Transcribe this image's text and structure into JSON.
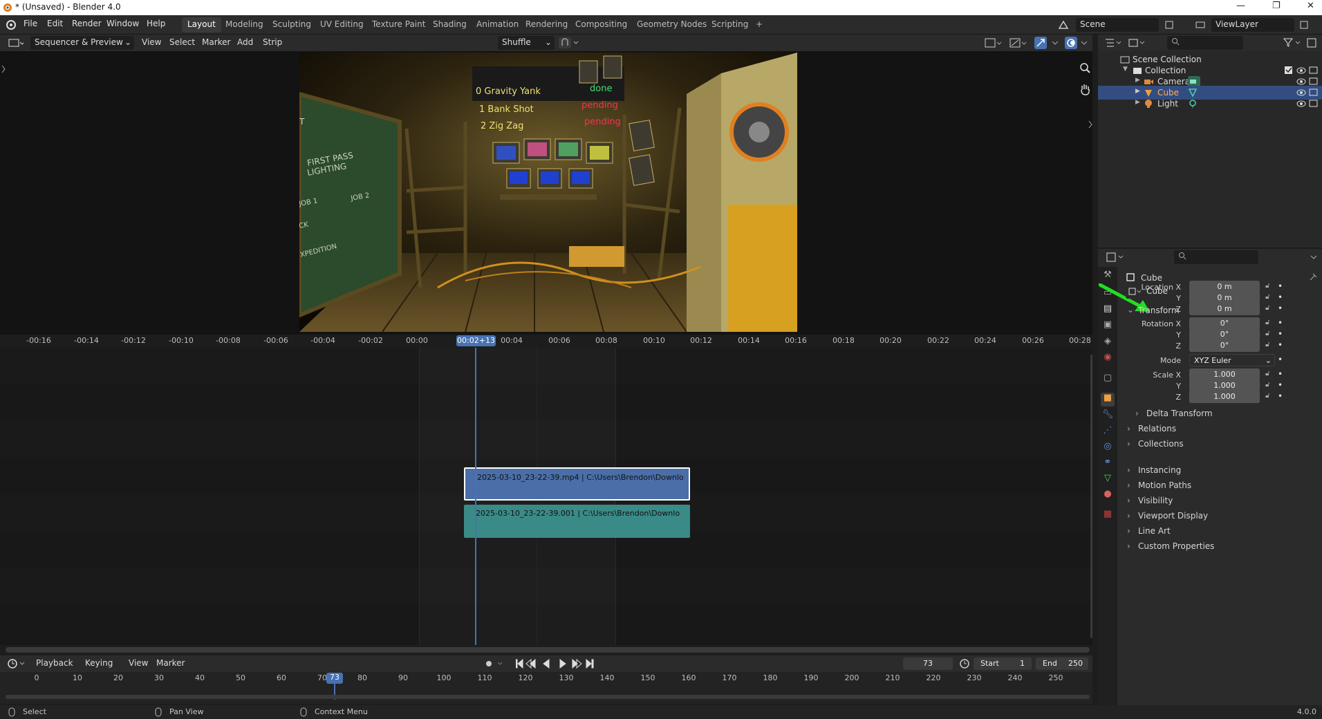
{
  "window": {
    "title": "* (Unsaved) - Blender 4.0",
    "minimize": "—",
    "maximize": "❐",
    "close": "✕"
  },
  "menu": {
    "items": [
      "File",
      "Edit",
      "Render",
      "Window",
      "Help"
    ]
  },
  "workspaces": {
    "tabs": [
      "Layout",
      "Modeling",
      "Sculpting",
      "UV Editing",
      "Texture Paint",
      "Shading",
      "Animation",
      "Rendering",
      "Compositing",
      "Geometry Nodes",
      "Scripting"
    ],
    "active": "Layout",
    "add": "+"
  },
  "scene": {
    "name": "Scene",
    "view_layer": "ViewLayer"
  },
  "sequencer": {
    "view_mode": "Sequencer & Preview",
    "menus": [
      "View",
      "Select",
      "Marker",
      "Add",
      "Strip"
    ],
    "overlap_mode": "Shuffle",
    "ruler_ticks": [
      "-00:16",
      "-00:14",
      "-00:12",
      "-00:10",
      "-00:08",
      "-00:06",
      "-00:04",
      "-00:02",
      "00:00",
      "00:04",
      "00:06",
      "00:08",
      "00:10",
      "00:12",
      "00:14",
      "00:16",
      "00:18",
      "00:20",
      "00:22",
      "00:24",
      "00:26",
      "00:28"
    ],
    "current_time": "00:02+13",
    "strips": [
      {
        "label": "2025-03-10_23-22-39.mp4 | C:\\Users\\Brendon\\Downlo",
        "type": "movie",
        "color": "#4a6ea8"
      },
      {
        "label": "2025-03-10_23-22-39.001 | C:\\Users\\Brendon\\Downlo",
        "type": "sound",
        "color": "#3a8a87"
      }
    ],
    "preview_text": {
      "board_lines": [
        "0 Gravity Yank",
        "1 Bank Shot",
        "2 Zig Zag"
      ],
      "board_status": [
        "done",
        "pending",
        "pending"
      ],
      "chalk_lines": [
        "FIRST PASS",
        "LIGHTING",
        "JOB 1",
        "JOB 2",
        "CK",
        "XPEDITION",
        "T"
      ]
    }
  },
  "timeline": {
    "menus": [
      "Playback",
      "Keying",
      "View",
      "Marker"
    ],
    "current_frame": "73",
    "start_label": "Start",
    "start": "1",
    "end_label": "End",
    "end": "250",
    "ticks": [
      "0",
      "10",
      "20",
      "30",
      "40",
      "50",
      "60",
      "70",
      "80",
      "90",
      "100",
      "110",
      "120",
      "130",
      "140",
      "150",
      "160",
      "170",
      "180",
      "190",
      "200",
      "210",
      "220",
      "230",
      "240",
      "250"
    ]
  },
  "status_bar": {
    "items": [
      "Select",
      "Pan View",
      "Context Menu"
    ],
    "version": "4.0.0"
  },
  "outliner": {
    "root": "Scene Collection",
    "collection": "Collection",
    "objects": [
      {
        "name": "Camera",
        "selected": false
      },
      {
        "name": "Cube",
        "selected": true
      },
      {
        "name": "Light",
        "selected": false
      }
    ]
  },
  "properties": {
    "object_name": "Cube",
    "datablock": "Cube",
    "transform_label": "Transform",
    "location_label": "Location X",
    "rotation_label": "Rotation X",
    "scale_label": "Scale X",
    "axis_y": "Y",
    "axis_z": "Z",
    "location": [
      "0 m",
      "0 m",
      "0 m"
    ],
    "rotation": [
      "0°",
      "0°",
      "0°"
    ],
    "mode_label": "Mode",
    "mode": "XYZ Euler",
    "scale": [
      "1.000",
      "1.000",
      "1.000"
    ],
    "delta_transform": "Delta Transform",
    "panels": [
      "Relations",
      "Collections",
      "Instancing",
      "Motion Paths",
      "Visibility",
      "Viewport Display",
      "Line Art",
      "Custom Properties"
    ]
  },
  "colors": {
    "accent": "#4772b3",
    "arrow": "#22dd22",
    "selected_row": "#334d80"
  }
}
